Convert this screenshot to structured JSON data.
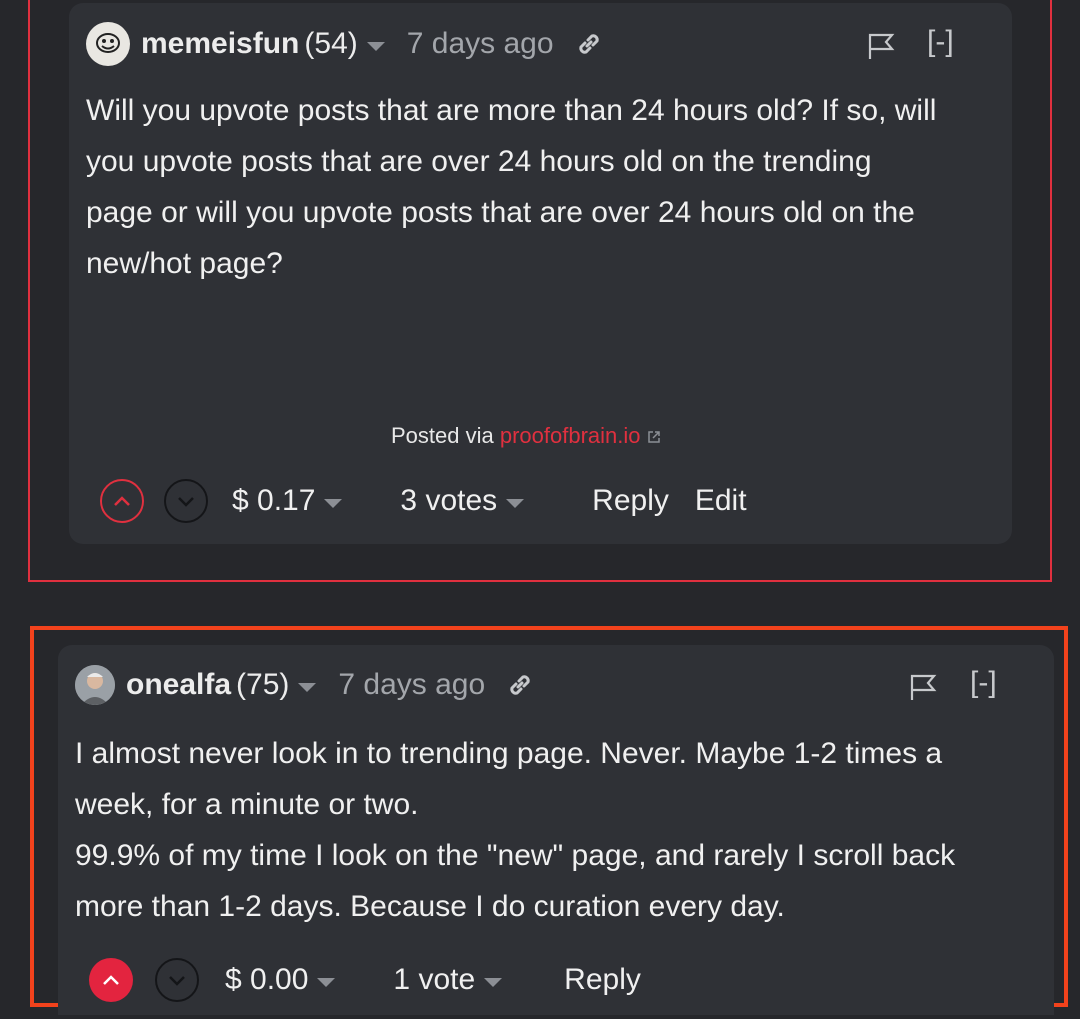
{
  "comments": [
    {
      "author": "memeisfun",
      "reputation": "(54)",
      "time": "7 days ago",
      "collapse": "[-]",
      "body_lines": [
        "Will you upvote posts that are more than 24 hours old? If so, will",
        "you upvote posts that are over 24 hours old on the trending",
        "page or will you upvote posts that are over 24 hours old on the",
        "new/hot page?"
      ],
      "posted_via_label": "Posted via",
      "posted_via_link": "proofofbrain.io",
      "payout": "$ 0.17",
      "votes": "3 votes",
      "reply": "Reply",
      "edit": "Edit"
    },
    {
      "author": "onealfa",
      "reputation": "(75)",
      "time": "7 days ago",
      "collapse": "[-]",
      "body_lines": [
        "I almost never look in to trending page. Never. Maybe 1-2 times a",
        "week, for a minute or two.",
        "99.9% of my time I look on the \"new\" page, and rarely I scroll back",
        "more than 1-2 days. Because I do curation every day."
      ],
      "payout": "$ 0.00",
      "votes": "1 vote",
      "reply": "Reply"
    }
  ],
  "colors": {
    "background": "#26272b",
    "card": "#2f3136",
    "accent_red": "#e0303f",
    "highlight_orange": "#f2421c"
  },
  "icons": {
    "link": "link-icon",
    "flag": "flag-icon",
    "upvote": "chevron-up-icon",
    "downvote": "chevron-down-icon",
    "external": "external-link-icon"
  }
}
